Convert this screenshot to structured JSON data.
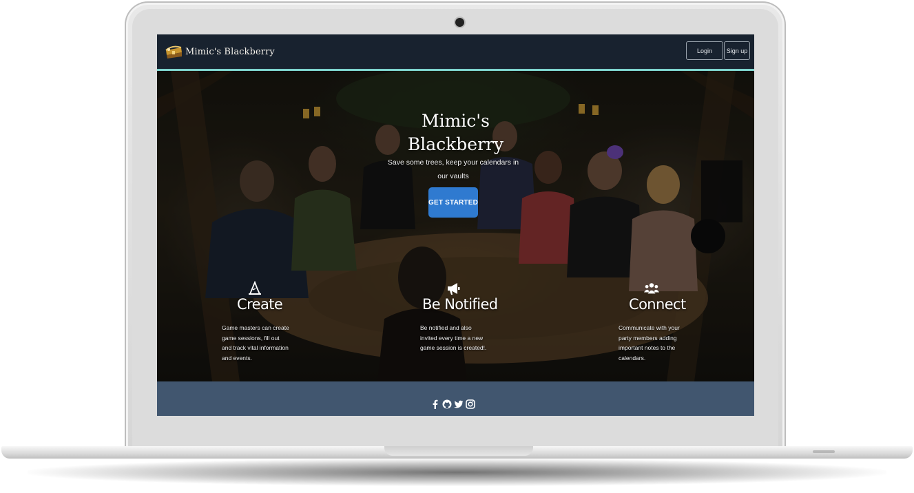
{
  "navbar": {
    "brand_name": "Mimic's Blackberry",
    "login_label": "Login",
    "signup_label": "Sign up"
  },
  "hero": {
    "title_line1": "Mimic's",
    "title_line2": "Blackberry",
    "subtitle": "Save some trees, keep your calendars in our vaults",
    "cta_label": "GET STARTED"
  },
  "features": [
    {
      "icon": "wizard-hat-icon",
      "title": "Create",
      "description": "Game masters can create game sessions, fill out and track vital information and events."
    },
    {
      "icon": "megaphone-icon",
      "title": "Be Notified",
      "description": "Be notified and also invited every time a new game session is created!."
    },
    {
      "icon": "users-icon",
      "title": "Connect",
      "description": "Communicate with your party members adding important notes to the calendars."
    }
  ],
  "footer": {
    "social_icons": [
      "facebook-icon",
      "github-icon",
      "twitter-icon",
      "instagram-icon"
    ]
  },
  "colors": {
    "navbar_bg": "#18222f",
    "navbar_accent": "#7fd6cf",
    "cta_bg": "#2f7ad0",
    "footer_bg": "#41566f"
  }
}
